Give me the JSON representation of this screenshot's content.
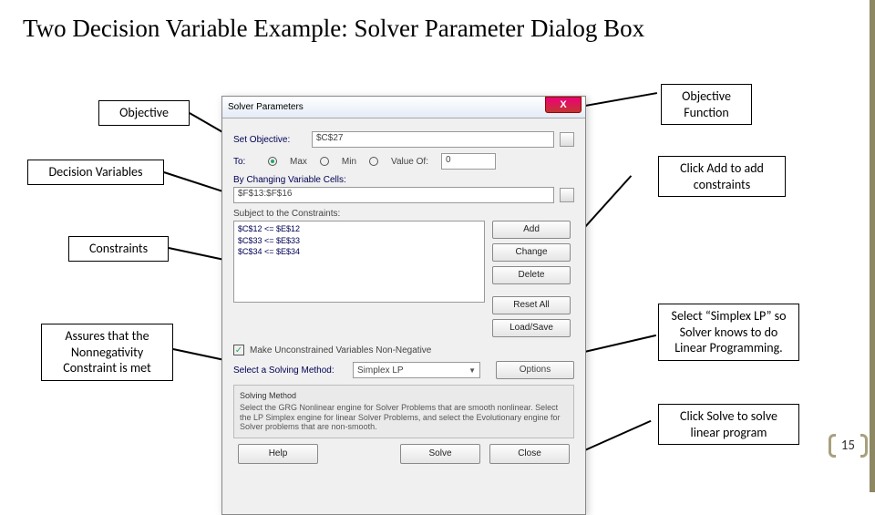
{
  "title": "Two Decision Variable Example: Solver Parameter Dialog Box",
  "callouts": {
    "objective": "Objective",
    "decision_vars": "Decision Variables",
    "constraints": "Constraints",
    "nonneg": "Assures that the Nonnegativity Constraint is met",
    "obj_func": "Objective Function",
    "click_add": "Click Add to add constraints",
    "simplex": "Select “Simplex LP” so Solver knows to do Linear Programming.",
    "solve": "Click Solve to solve linear program"
  },
  "dialog": {
    "title": "Solver Parameters",
    "close": "X",
    "set_objective_label": "Set Objective:",
    "objective_field": "$C$27",
    "to_label": "To:",
    "radios": {
      "max": "Max",
      "min": "Min",
      "valueof": "Value Of:"
    },
    "valueof_field": "0",
    "changing_label": "By Changing Variable Cells:",
    "changing_field": "$F$13:$F$16",
    "subject_label": "Subject to the Constraints:",
    "constraints": [
      "$C$12 <= $E$12",
      "$C$33 <= $E$33",
      "$C$34 <= $E$34"
    ],
    "buttons": {
      "add": "Add",
      "change": "Change",
      "delete": "Delete",
      "resetall": "Reset All",
      "loadsave": "Load/Save",
      "options": "Options",
      "help": "Help",
      "solve": "Solve",
      "close": "Close"
    },
    "nonneg_check": "Make Unconstrained Variables Non-Negative",
    "method_label": "Select a Solving Method:",
    "method_value": "Simplex LP",
    "help_heading": "Solving Method",
    "help_text": "Select the GRG Nonlinear engine for Solver Problems that are smooth nonlinear. Select the LP Simplex engine for linear Solver Problems, and select the Evolutionary engine for Solver problems that are non-smooth."
  },
  "page_number": "15"
}
